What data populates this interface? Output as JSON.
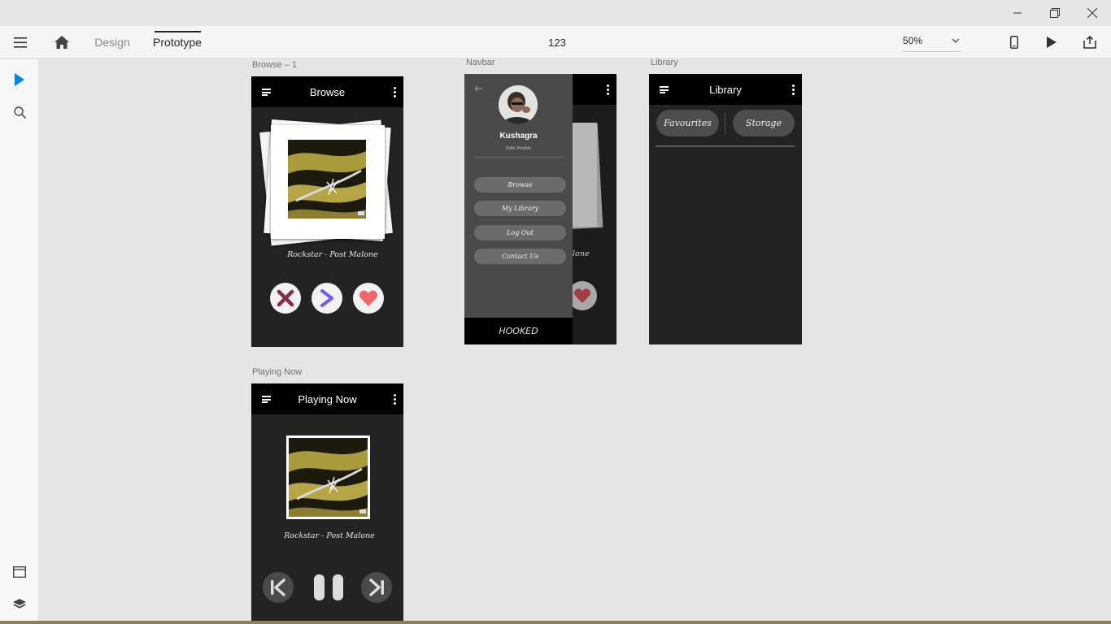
{
  "toolbar": {
    "design_label": "Design",
    "prototype_label": "Prototype",
    "doc_title": "123",
    "zoom_value": "50%"
  },
  "artboards": {
    "browse": {
      "label": "Browse – 1",
      "title": "Browse",
      "song": "Rockstar - Post Malone"
    },
    "navbar": {
      "label": "Navbar",
      "user_name": "Kushagra",
      "edit_profile": "Edit Profile",
      "menu": [
        "Browse",
        "My Library",
        "Log Out",
        "Contact Us"
      ],
      "brand": "HOOKED",
      "behind_song_fragment": "lone"
    },
    "library": {
      "label": "Library",
      "title": "Library",
      "tabs": [
        "Favourites",
        "Storage"
      ]
    },
    "playing": {
      "label": "Playing Now",
      "title": "Playing Now",
      "song": "Rockstar - Post Malone"
    }
  },
  "colors": {
    "accent": "#0a84d6",
    "dislike": "#8b2a4a",
    "next": "#6f5cf0",
    "like": "#f2676e"
  },
  "icons": [
    "hamburger-icon",
    "home-icon",
    "device-preview-icon",
    "play-icon",
    "share-icon",
    "select-arrow-icon",
    "search-icon",
    "artboard-icon",
    "layers-icon"
  ]
}
